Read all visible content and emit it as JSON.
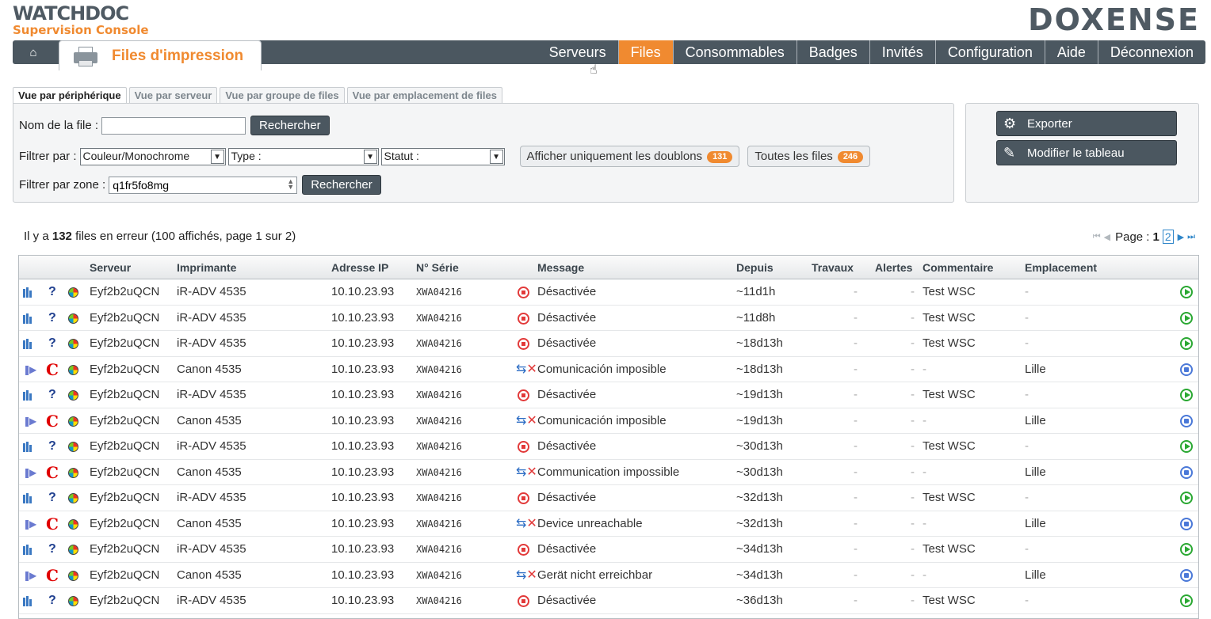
{
  "brand": {
    "name": "WATCHDOC",
    "subtitle": "Supervision Console",
    "vendor": "DOXENSE"
  },
  "page": {
    "title": "Files d'impression"
  },
  "nav": [
    "Serveurs",
    "Files",
    "Consommables",
    "Badges",
    "Invités",
    "Configuration",
    "Aide",
    "Déconnexion"
  ],
  "nav_active": "Files",
  "subtabs": [
    "Vue par périphérique",
    "Vue par serveur",
    "Vue par groupe de files",
    "Vue par emplacement de files"
  ],
  "filters": {
    "queue_label": "Nom de la file :",
    "queue_value": "",
    "search_label": "Rechercher",
    "filter_by_label": "Filtrer par :",
    "color_select": "Couleur/Monochrome",
    "type_select": "Type :",
    "status_select": "Statut :",
    "duplicates_label": "Afficher uniquement les doublons",
    "duplicates_count": "131",
    "all_label": "Toutes les files",
    "all_count": "246",
    "zone_label": "Filtrer par zone :",
    "zone_value": "q1fr5fo8mg",
    "zone_search_label": "Rechercher"
  },
  "actions": {
    "export": "Exporter",
    "edit_table": "Modifier le tableau"
  },
  "summary": {
    "prefix": "Il y a",
    "count": "132",
    "suffix": "files en erreur (100 affichés, page 1 sur 2)"
  },
  "pagination": {
    "label": "Page :",
    "current": "1",
    "next": "2"
  },
  "columns": [
    "Serveur",
    "Imprimante",
    "Adresse IP",
    "N° Série",
    "Message",
    "Depuis",
    "Travaux",
    "Alertes",
    "Commentaire",
    "Emplacement"
  ],
  "rows": [
    {
      "kind": "a",
      "server": "Eyf2b2uQCN",
      "printer": "iR-ADV 4535",
      "ip": "10.10.23.93",
      "serial": "XWA04216",
      "message": "Désactivée",
      "since": "~11d1h",
      "jobs": "-",
      "alerts": "-",
      "comment": "Test WSC",
      "location": "-"
    },
    {
      "kind": "a",
      "server": "Eyf2b2uQCN",
      "printer": "iR-ADV 4535",
      "ip": "10.10.23.93",
      "serial": "XWA04216",
      "message": "Désactivée",
      "since": "~11d8h",
      "jobs": "-",
      "alerts": "-",
      "comment": "Test WSC",
      "location": "-"
    },
    {
      "kind": "a",
      "server": "Eyf2b2uQCN",
      "printer": "iR-ADV 4535",
      "ip": "10.10.23.93",
      "serial": "XWA04216",
      "message": "Désactivée",
      "since": "~18d13h",
      "jobs": "-",
      "alerts": "-",
      "comment": "Test WSC",
      "location": "-"
    },
    {
      "kind": "b",
      "server": "Eyf2b2uQCN",
      "printer": "Canon 4535",
      "ip": "10.10.23.93",
      "serial": "XWA04216",
      "message": "Comunicación imposible",
      "since": "~18d13h",
      "jobs": "-",
      "alerts": "-",
      "comment": "-",
      "location": "Lille"
    },
    {
      "kind": "a",
      "server": "Eyf2b2uQCN",
      "printer": "iR-ADV 4535",
      "ip": "10.10.23.93",
      "serial": "XWA04216",
      "message": "Désactivée",
      "since": "~19d13h",
      "jobs": "-",
      "alerts": "-",
      "comment": "Test WSC",
      "location": "-"
    },
    {
      "kind": "b",
      "server": "Eyf2b2uQCN",
      "printer": "Canon 4535",
      "ip": "10.10.23.93",
      "serial": "XWA04216",
      "message": "Comunicación imposible",
      "since": "~19d13h",
      "jobs": "-",
      "alerts": "-",
      "comment": "-",
      "location": "Lille"
    },
    {
      "kind": "a",
      "server": "Eyf2b2uQCN",
      "printer": "iR-ADV 4535",
      "ip": "10.10.23.93",
      "serial": "XWA04216",
      "message": "Désactivée",
      "since": "~30d13h",
      "jobs": "-",
      "alerts": "-",
      "comment": "Test WSC",
      "location": "-"
    },
    {
      "kind": "b",
      "server": "Eyf2b2uQCN",
      "printer": "Canon 4535",
      "ip": "10.10.23.93",
      "serial": "XWA04216",
      "message": "Communication impossible",
      "since": "~30d13h",
      "jobs": "-",
      "alerts": "-",
      "comment": "-",
      "location": "Lille"
    },
    {
      "kind": "a",
      "server": "Eyf2b2uQCN",
      "printer": "iR-ADV 4535",
      "ip": "10.10.23.93",
      "serial": "XWA04216",
      "message": "Désactivée",
      "since": "~32d13h",
      "jobs": "-",
      "alerts": "-",
      "comment": "Test WSC",
      "location": "-"
    },
    {
      "kind": "b",
      "server": "Eyf2b2uQCN",
      "printer": "Canon 4535",
      "ip": "10.10.23.93",
      "serial": "XWA04216",
      "message": "Device unreachable",
      "since": "~32d13h",
      "jobs": "-",
      "alerts": "-",
      "comment": "-",
      "location": "Lille"
    },
    {
      "kind": "a",
      "server": "Eyf2b2uQCN",
      "printer": "iR-ADV 4535",
      "ip": "10.10.23.93",
      "serial": "XWA04216",
      "message": "Désactivée",
      "since": "~34d13h",
      "jobs": "-",
      "alerts": "-",
      "comment": "Test WSC",
      "location": "-"
    },
    {
      "kind": "b",
      "server": "Eyf2b2uQCN",
      "printer": "Canon 4535",
      "ip": "10.10.23.93",
      "serial": "XWA04216",
      "message": "Gerät nicht erreichbar",
      "since": "~34d13h",
      "jobs": "-",
      "alerts": "-",
      "comment": "-",
      "location": "Lille"
    },
    {
      "kind": "a",
      "server": "Eyf2b2uQCN",
      "printer": "iR-ADV 4535",
      "ip": "10.10.23.93",
      "serial": "XWA04216",
      "message": "Désactivée",
      "since": "~36d13h",
      "jobs": "-",
      "alerts": "-",
      "comment": "Test WSC",
      "location": "-"
    }
  ],
  "icons": {
    "stats": "bar-chart-icon",
    "unknown": "question-icon",
    "canon": "canon-logo-icon",
    "color": "color-wheel-icon",
    "disabled": "stop-circle-icon",
    "unreachable": "network-error-icon",
    "resume": "play-circle-icon",
    "pause": "pause-circle-icon"
  },
  "colors": {
    "accent": "#f08a30",
    "nav": "#4b5760",
    "link": "#2f86c9",
    "error": "#e23a3a",
    "ok": "#2aa832"
  }
}
